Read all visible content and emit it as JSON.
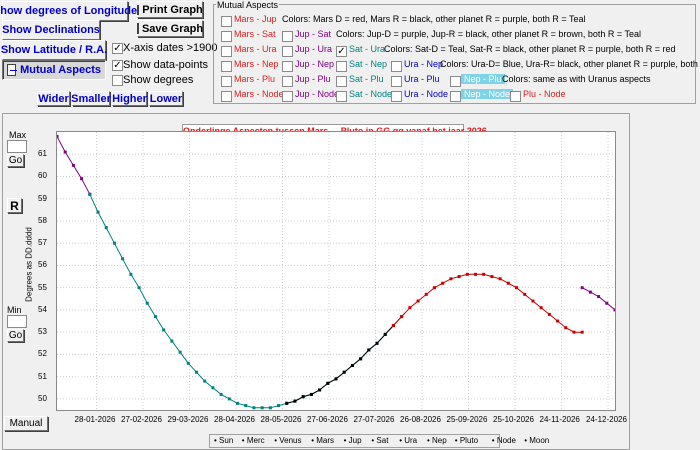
{
  "left_buttons": {
    "longitude": "Show degrees of Longitude",
    "declinations": "Show Declinations",
    "latitude": "Show Latitude  / R.A.",
    "mutual": "Mutual Aspects"
  },
  "graph_buttons": {
    "print": "Print Graph",
    "save": "Save Graph"
  },
  "options": {
    "xaxis_dates": {
      "label": "X-axis dates >1900",
      "checked": true
    },
    "show_points": {
      "label": "Show data-points",
      "checked": true
    },
    "show_degrees": {
      "label": "Show degrees",
      "checked": false
    }
  },
  "zoom_buttons": {
    "wider": "Wider",
    "smaller": "Smaller",
    "higher": "Higher",
    "lower": "Lower"
  },
  "mutual_aspects": {
    "title": "Mutual Aspects",
    "rows": [
      {
        "label": "Mars - Jup",
        "checked": false,
        "desc": "Colors: Mars D = red, Mars R = black, other planet R = purple, both R = Teal"
      },
      {
        "label": "Mars - Sat",
        "checked": false
      },
      {
        "label": "Jup - Sat",
        "checked": false,
        "desc": "Colors: Jup-D = purple, Jup-R = black, other planet R = brown, both R = Teal"
      },
      {
        "label": "Mars - Ura",
        "checked": false
      },
      {
        "label": "Jup - Ura",
        "checked": false
      },
      {
        "label": "Sat - Ura",
        "checked": true,
        "desc": "Colors: Sat-D = Teal, Sat-R = black, other planet R = purple, both R = red"
      },
      {
        "label": "Mars - Nep",
        "checked": false
      },
      {
        "label": "Jup - Nep",
        "checked": false
      },
      {
        "label": "Sat - Nep",
        "checked": false
      },
      {
        "label": "Ura - Nep",
        "checked": false,
        "desc": "Colors: Ura-D= Blue, Ura-R= black, other planet R = purple, both R = red"
      },
      {
        "label": "Mars - Plu",
        "checked": false
      },
      {
        "label": "Jup - Plu",
        "checked": false
      },
      {
        "label": "Sat - Plu",
        "checked": false
      },
      {
        "label": "Ura - Plu",
        "checked": false
      },
      {
        "label": "Nep - Plu",
        "checked": false,
        "desc": "Colors: same as with Uranus aspects"
      },
      {
        "label": "Mars - Node",
        "checked": false
      },
      {
        "label": "Jup - Node",
        "checked": false
      },
      {
        "label": "Sat - Node",
        "checked": false
      },
      {
        "label": "Ura - Node",
        "checked": false
      },
      {
        "label": "Nep - Node",
        "checked": false
      },
      {
        "label": "Plu - Node",
        "checked": false
      }
    ]
  },
  "left_panel": {
    "max_label": "Max",
    "min_label": "Min",
    "go": "Go",
    "r": "R",
    "manual": "Manual"
  },
  "chart_data": {
    "type": "line",
    "title": "Onderlinge Aspecten tussen Mars ...  Pluto in GG.gg vanaf het jaar 2026",
    "ylabel": "Degrees as DD.dddd",
    "ylim": [
      49.5,
      62
    ],
    "yticks": [
      "50",
      "51",
      "52",
      "53",
      "54",
      "55",
      "56",
      "57",
      "58",
      "59",
      "60",
      "61"
    ],
    "xticks": [
      "28-01-2026",
      "27-02-2026",
      "29-03-2026",
      "28-04-2026",
      "28-05-2026",
      "27-06-2026",
      "27-07-2026",
      "26-08-2026",
      "25-09-2026",
      "25-10-2026",
      "24-11-2026",
      "24-12-2026"
    ],
    "grid": true,
    "colors": {
      "purple": "#800080",
      "teal": "#008080",
      "black": "#000000",
      "red": "#cc0000"
    },
    "series": [
      {
        "color": "purple",
        "x": [
          0,
          5,
          10,
          15,
          20
        ],
        "y": [
          61.8,
          61.1,
          60.5,
          59.9,
          59.2
        ]
      },
      {
        "color": "teal",
        "x": [
          20,
          25,
          30,
          35,
          40,
          45,
          50,
          55,
          60,
          65,
          70,
          75,
          80,
          85,
          90,
          95,
          100,
          105,
          110,
          115,
          120,
          125,
          130,
          135,
          140,
          145,
          150,
          155,
          160,
          165,
          170,
          175,
          180,
          185,
          190,
          195,
          200,
          205,
          210
        ],
        "y": [
          59.2,
          58.4,
          57.7,
          57.0,
          56.3,
          55.6,
          55.0,
          54.3,
          53.7,
          53.1,
          52.6,
          52.1,
          51.6,
          51.2,
          50.8,
          50.5,
          50.2,
          50.0,
          49.8,
          49.7,
          49.6,
          49.6,
          49.6,
          49.7,
          49.8,
          49.9,
          50.1,
          50.2,
          50.4,
          50.7,
          50.9,
          51.2,
          51.5,
          51.8,
          52.2,
          52.5,
          52.9,
          53.3,
          53.7
        ]
      },
      {
        "color": "black",
        "x": [
          140,
          145,
          150,
          155,
          160,
          165,
          170,
          175,
          180,
          185,
          190,
          195,
          200,
          205
        ],
        "y": [
          49.8,
          49.9,
          50.1,
          50.2,
          50.4,
          50.7,
          50.9,
          51.2,
          51.5,
          51.8,
          52.2,
          52.5,
          52.9,
          53.3
        ]
      },
      {
        "color": "red",
        "x": [
          205,
          210,
          215,
          220,
          225,
          230,
          235,
          240,
          245,
          250,
          255,
          260,
          265,
          270,
          275,
          280,
          285,
          290,
          295,
          300,
          305,
          310,
          315,
          320
        ],
        "y": [
          53.3,
          53.7,
          54.1,
          54.4,
          54.7,
          55.0,
          55.2,
          55.4,
          55.5,
          55.6,
          55.6,
          55.6,
          55.5,
          55.4,
          55.2,
          55.0,
          54.7,
          54.4,
          54.1,
          53.8,
          53.5,
          53.2,
          53.0,
          53.0
        ]
      },
      {
        "color": "purple",
        "x": [
          320,
          325,
          330,
          335,
          340
        ],
        "y": [
          55.0,
          54.8,
          54.6,
          54.3,
          54.0
        ]
      }
    ],
    "legend": [
      "Sun",
      "Merc",
      "Venus",
      "Mars",
      "Jup",
      "Sat",
      "Ura",
      "Nep",
      "Pluto",
      "Node",
      "Moon"
    ]
  }
}
